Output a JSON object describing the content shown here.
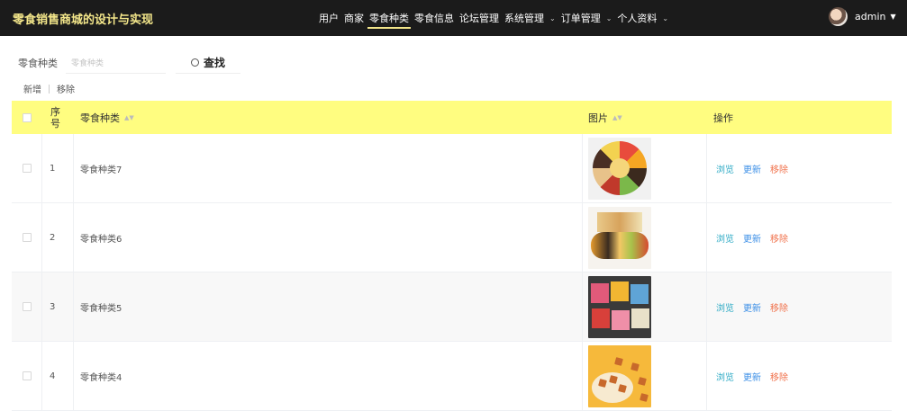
{
  "app": {
    "title": "零食销售商城的设计与实现"
  },
  "nav": {
    "items": [
      {
        "label": "用户",
        "chevron": false
      },
      {
        "label": "商家",
        "chevron": false
      },
      {
        "label": "零食种类",
        "chevron": false,
        "active": true
      },
      {
        "label": "零食信息",
        "chevron": false
      },
      {
        "label": "论坛管理",
        "chevron": false
      },
      {
        "label": "系统管理",
        "chevron": true
      },
      {
        "label": "订单管理",
        "chevron": true
      },
      {
        "label": "个人资料",
        "chevron": true
      }
    ]
  },
  "user": {
    "name": "admin",
    "caret": "▼"
  },
  "search": {
    "label": "零食种类",
    "placeholder": "零食种类",
    "value": "",
    "button": "查找",
    "icon": "search-icon"
  },
  "toolbar": {
    "add": "新增",
    "remove": "移除"
  },
  "table": {
    "headers": {
      "index": "序号",
      "name": "零食种类",
      "image": "图片",
      "actions": "操作"
    },
    "rows": [
      {
        "index": "1",
        "name": "零食种类7",
        "image": "snack-platter-image",
        "view": "浏览",
        "edit": "更新",
        "delete": "移除"
      },
      {
        "index": "2",
        "name": "零食种类6",
        "image": "snack-assortment-image",
        "view": "浏览",
        "edit": "更新",
        "delete": "移除"
      },
      {
        "index": "3",
        "name": "零食种类5",
        "image": "snack-box-image",
        "view": "浏览",
        "edit": "更新",
        "delete": "移除"
      },
      {
        "index": "4",
        "name": "零食种类4",
        "image": "biscuit-plate-image",
        "view": "浏览",
        "edit": "更新",
        "delete": "移除"
      }
    ]
  },
  "colors": {
    "topbar": "#1b1b1b",
    "brand": "#f3e68a",
    "header_row": "#fffd80",
    "view": "#2aa9c4",
    "edit": "#3a8ee6",
    "delete": "#f0714b"
  }
}
